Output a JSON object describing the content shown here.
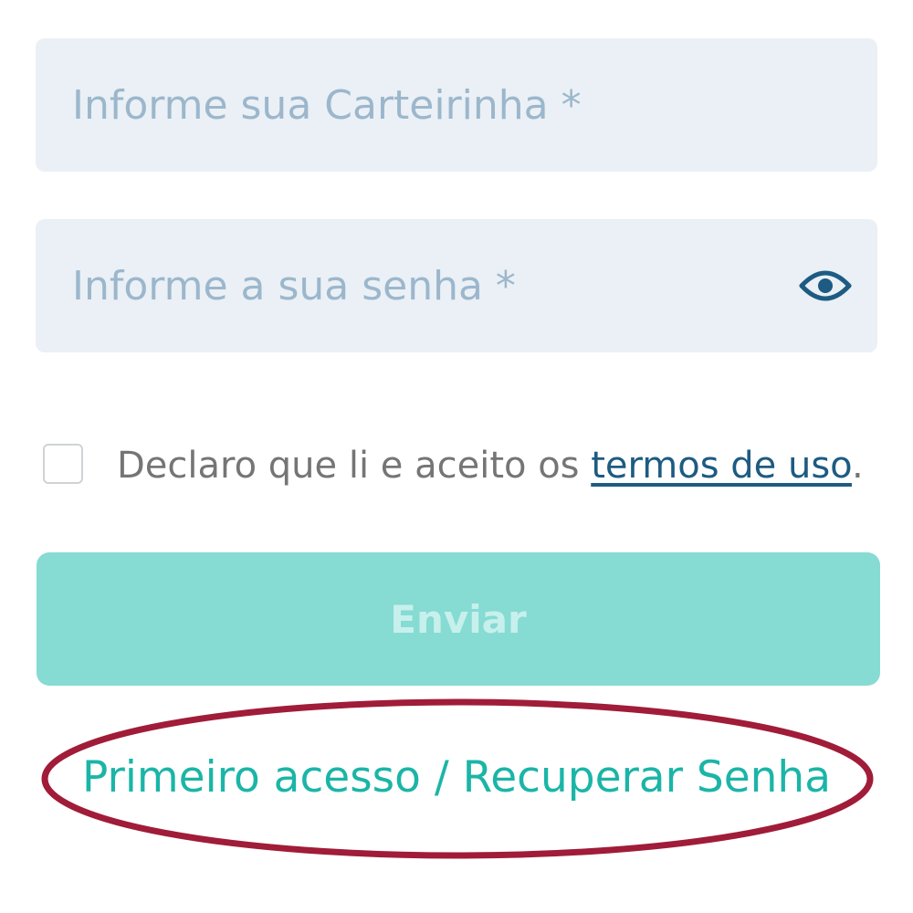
{
  "login_form": {
    "card_field": {
      "placeholder": "Informe sua Carteirinha *",
      "value": ""
    },
    "password_field": {
      "placeholder": "Informe a sua senha *",
      "value": "",
      "toggle_icon": "eye-icon"
    },
    "terms": {
      "checked": false,
      "prefix": "Declaro que li e aceito os ",
      "link_label": "termos de uso",
      "suffix": "."
    },
    "submit_label": "Enviar",
    "first_access_label": "Primeiro acesso / Recuperar Senha"
  },
  "colors": {
    "field_background": "#eaf0f5",
    "placeholder": "#9cb7cc",
    "icon": "#1d5b82",
    "link": "#1d5b82",
    "button_disabled": "#86dbd3",
    "teal_link": "#1bb5a7",
    "highlight_ellipse": "#a01c38"
  }
}
